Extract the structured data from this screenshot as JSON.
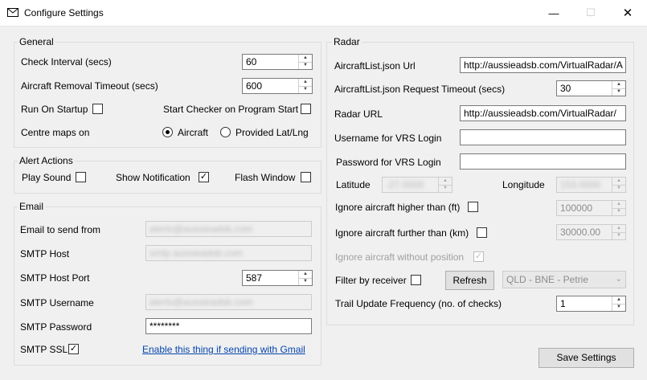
{
  "window": {
    "title": "Configure Settings",
    "minimize_glyph": "—",
    "maximize_glyph": "☐",
    "close_glyph": "✕"
  },
  "general": {
    "legend": "General",
    "check_interval_label": "Check Interval (secs)",
    "check_interval_value": "60",
    "removal_timeout_label": "Aircraft Removal Timeout (secs)",
    "removal_timeout_value": "600",
    "run_on_startup_label": "Run On Startup",
    "run_on_startup_checked": false,
    "start_checker_label": "Start Checker on Program Start",
    "start_checker_checked": false,
    "centre_maps_label": "Centre maps on",
    "radio_aircraft_label": "Aircraft",
    "radio_provided_label": "Provided Lat/Lng",
    "centre_selected": "Aircraft"
  },
  "alert_actions": {
    "legend": "Alert Actions",
    "play_sound_label": "Play Sound",
    "play_sound_checked": false,
    "show_notification_label": "Show Notification",
    "show_notification_checked": true,
    "flash_window_label": "Flash Window",
    "flash_window_checked": false
  },
  "email": {
    "legend": "Email",
    "send_from_label": "Email to send from",
    "send_from_value": "alerts@aussieadsb.com",
    "smtp_host_label": "SMTP Host",
    "smtp_host_value": "smtp.aussieadsb.com",
    "smtp_port_label": "SMTP Host Port",
    "smtp_port_value": "587",
    "smtp_username_label": "SMTP Username",
    "smtp_username_value": "alerts@aussieadsb.com",
    "smtp_password_label": "SMTP Password",
    "smtp_password_value": "********",
    "smtp_ssl_label": "SMTP SSL",
    "smtp_ssl_checked": true,
    "gmail_link": "Enable this thing if sending with Gmail"
  },
  "radar": {
    "legend": "Radar",
    "aircraftlist_url_label": "AircraftList.json Url",
    "aircraftlist_url_value": "http://aussieadsb.com/VirtualRadar/A",
    "request_timeout_label": "AircraftList.json Request Timeout (secs)",
    "request_timeout_value": "30",
    "radar_url_label": "Radar URL",
    "radar_url_value": "http://aussieadsb.com/VirtualRadar/",
    "vrs_username_label": "Username for VRS Login",
    "vrs_username_value": "",
    "vrs_password_label": "Password for VRS Login",
    "vrs_password_value": "",
    "latitude_label": "Latitude",
    "latitude_value": "-27.0000",
    "longitude_label": "Longitude",
    "longitude_value": "153.0000",
    "ignore_higher_label": "Ignore aircraft higher than (ft)",
    "ignore_higher_checked": false,
    "ignore_higher_value": "100000",
    "ignore_further_label": "Ignore aircraft further than (km)",
    "ignore_further_checked": false,
    "ignore_further_value": "30000.00",
    "ignore_without_position_label": "Ignore aircraft without position",
    "ignore_without_position_checked": true,
    "filter_receiver_label": "Filter by receiver",
    "filter_receiver_checked": false,
    "refresh_label": "Refresh",
    "receiver_selected": "QLD - BNE - Petrie",
    "trail_update_label": "Trail Update Frequency (no. of checks)",
    "trail_update_value": "1"
  },
  "save_label": "Save Settings",
  "glyphs": {
    "check": "✓",
    "spin_up": "▲",
    "spin_down": "▼",
    "dropdown": "⌄"
  }
}
